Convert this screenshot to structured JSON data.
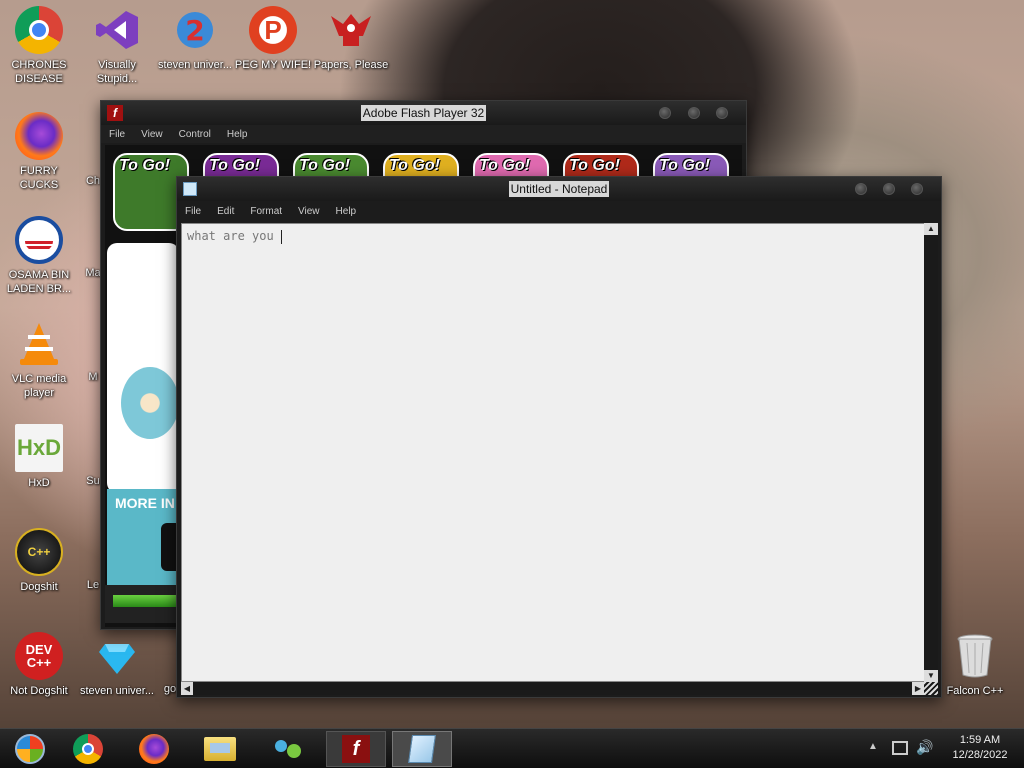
{
  "desktop": {
    "icons": [
      {
        "label": "CHRONES DISEASE",
        "icon": "chrome-icon"
      },
      {
        "label": "Visually Stupid...",
        "icon": "visual-studio-icon"
      },
      {
        "label": "steven univer...",
        "icon": "steven-universe-icon"
      },
      {
        "label": "PEG MY WIFE!",
        "icon": "peggle-icon"
      },
      {
        "label": "Papers, Please",
        "icon": "papers-please-icon"
      },
      {
        "label": "FURRY CUCKS",
        "icon": "firefox-icon"
      },
      {
        "label": "OSAMA BIN LADEN BR...",
        "icon": "obama-logo-icon"
      },
      {
        "label": "VLC media player",
        "icon": "vlc-icon"
      },
      {
        "label": "HxD",
        "icon": "hxd-icon"
      },
      {
        "label": "Dogshit",
        "icon": "codeblocks-icon"
      },
      {
        "label": "Not Dogshit",
        "icon": "devcpp-icon"
      },
      {
        "label": "steven univer...",
        "icon": "diamond-icon"
      },
      {
        "label": "go",
        "icon": "partial-icon"
      },
      {
        "label": "Falcon C++",
        "icon": "recycle-bin-icon"
      },
      {
        "label": "Ch",
        "icon": "partial-icon"
      },
      {
        "label": "Ma",
        "icon": "partial-icon"
      },
      {
        "label": "M",
        "icon": "partial-icon"
      },
      {
        "label": "Su",
        "icon": "partial-icon"
      },
      {
        "label": "Le",
        "icon": "partial-icon"
      }
    ]
  },
  "flash_window": {
    "title": "Adobe Flash Player 32",
    "menu": [
      "File",
      "View",
      "Control",
      "Help"
    ],
    "game_tiles": [
      "To Go!",
      "To Go!",
      "To Go!",
      "To Go!",
      "To Go!",
      "To Go!",
      "To Go!"
    ],
    "tile_colors": [
      "#3e7a2a",
      "#7a2b96",
      "#4a8a30",
      "#e0b020",
      "#e06ab0",
      "#b02a1a",
      "#8a5ab8"
    ],
    "more_text": "MORE IN"
  },
  "notepad_window": {
    "title": "Untitled - Notepad",
    "menu": [
      "File",
      "Edit",
      "Format",
      "View",
      "Help"
    ],
    "content": "what are you "
  },
  "taskbar": {
    "clock_time": "1:59 AM",
    "clock_date": "12/28/2022",
    "apps": [
      "start-orb",
      "chrome",
      "firefox",
      "file-explorer",
      "network-people",
      "flash-player",
      "notepad"
    ]
  }
}
